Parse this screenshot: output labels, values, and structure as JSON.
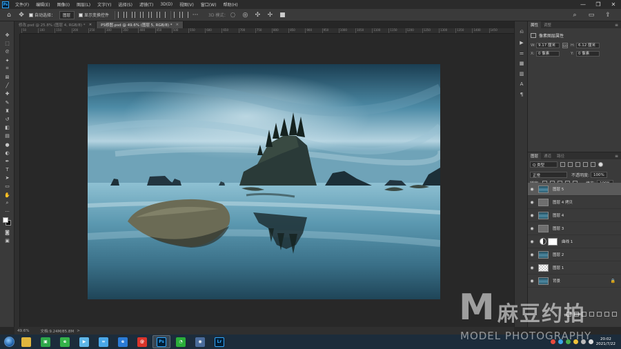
{
  "app": {
    "logo": "Ps"
  },
  "menu": [
    "文件(F)",
    "编辑(E)",
    "图像(I)",
    "图层(L)",
    "文字(Y)",
    "选择(S)",
    "滤镜(T)",
    "3D(D)",
    "视图(V)",
    "窗口(W)",
    "帮助(H)"
  ],
  "window_controls": {
    "minimize": "—",
    "maximize": "❐",
    "close": "✕"
  },
  "options": {
    "auto_select_label": "自动选择：",
    "auto_select_value": "图层",
    "transform_label": "显示变换控件",
    "mode_3d": "3D 模式："
  },
  "tabs": [
    {
      "label": "修改.psd @ 25.8% (图层 4, RGB/8) *",
      "close": "×"
    },
    {
      "label": "PS修图.psd @ 49.6% (图层 5, RGB/8) *",
      "close": "×"
    }
  ],
  "ruler_ticks": [
    "50",
    "100",
    "150",
    "200",
    "250",
    "300",
    "350",
    "400",
    "450",
    "500",
    "550",
    "600",
    "650",
    "700",
    "750",
    "800",
    "850",
    "900",
    "950",
    "1000",
    "1050",
    "1100",
    "1150",
    "1200",
    "1250",
    "1300",
    "1350",
    "1400",
    "1450"
  ],
  "status": {
    "zoom": "49.6%",
    "doc": "文档:9.24M/85.8M",
    "arrow": ">"
  },
  "properties": {
    "tabs": [
      "属性",
      "调整"
    ],
    "title": "像素图层属性",
    "w_label": "W:",
    "w_value": "9.17 厘米",
    "h_label": "H:",
    "h_value": "6.12 厘米",
    "x_label": "X:",
    "x_value": "0 像素",
    "y_label": "Y:",
    "y_value": "0 像素",
    "link": "GO"
  },
  "layers_panel": {
    "tabs": [
      "图层",
      "通道",
      "路径"
    ],
    "filter": "Q 类型",
    "blend": "正常",
    "opacity_label": "不透明度:",
    "opacity_value": "100%",
    "lock_label": "锁定:",
    "fill_label": "填充:",
    "fill_value": "100%",
    "layers": [
      {
        "name": "图层 5",
        "thumb": "img",
        "selected": true
      },
      {
        "name": "图层 4 拷贝",
        "thumb": "gray",
        "selected": false
      },
      {
        "name": "图层 4",
        "thumb": "img",
        "selected": false
      },
      {
        "name": "图层 3",
        "thumb": "gray",
        "selected": false
      },
      {
        "name": "曲线 1",
        "thumb": "adj",
        "selected": false
      },
      {
        "name": "图层 2",
        "thumb": "img",
        "selected": false
      },
      {
        "name": "图层 1",
        "thumb": "checker",
        "selected": false
      },
      {
        "name": "背景",
        "thumb": "img",
        "selected": false,
        "locked": true
      }
    ]
  },
  "taskbar": {
    "apps": [
      {
        "icon": "folder-icon",
        "glyph": "",
        "color": "#e2b63d"
      },
      {
        "icon": "media-app-icon",
        "glyph": "▣",
        "color": "#2ea84a"
      },
      {
        "icon": "ie-green-icon",
        "glyph": "e",
        "color": "#35b34a"
      },
      {
        "icon": "play-icon",
        "glyph": "▶",
        "color": "#5fb6e8"
      },
      {
        "icon": "cloud-icon",
        "glyph": "∞",
        "color": "#4aa7e8"
      },
      {
        "icon": "ie-icon",
        "glyph": "e",
        "color": "#2b7bd6"
      },
      {
        "icon": "weibo-icon",
        "glyph": "@",
        "color": "#d9342b"
      },
      {
        "icon": "photoshop-icon",
        "glyph": "Ps",
        "color": "#001e36",
        "active": true
      },
      {
        "icon": "wechat-icon",
        "glyph": "◔",
        "color": "#2aae3a"
      },
      {
        "icon": "c4d-icon",
        "glyph": "◉",
        "color": "#4a6b9a"
      },
      {
        "icon": "lightroom-icon",
        "glyph": "Lr",
        "color": "#001e36"
      }
    ],
    "time": "20:02",
    "date": "2021/7/22"
  },
  "watermark": {
    "letter": "M",
    "cn": "麻豆约拍",
    "en": "MODEL PHOTOGRAPHY"
  }
}
